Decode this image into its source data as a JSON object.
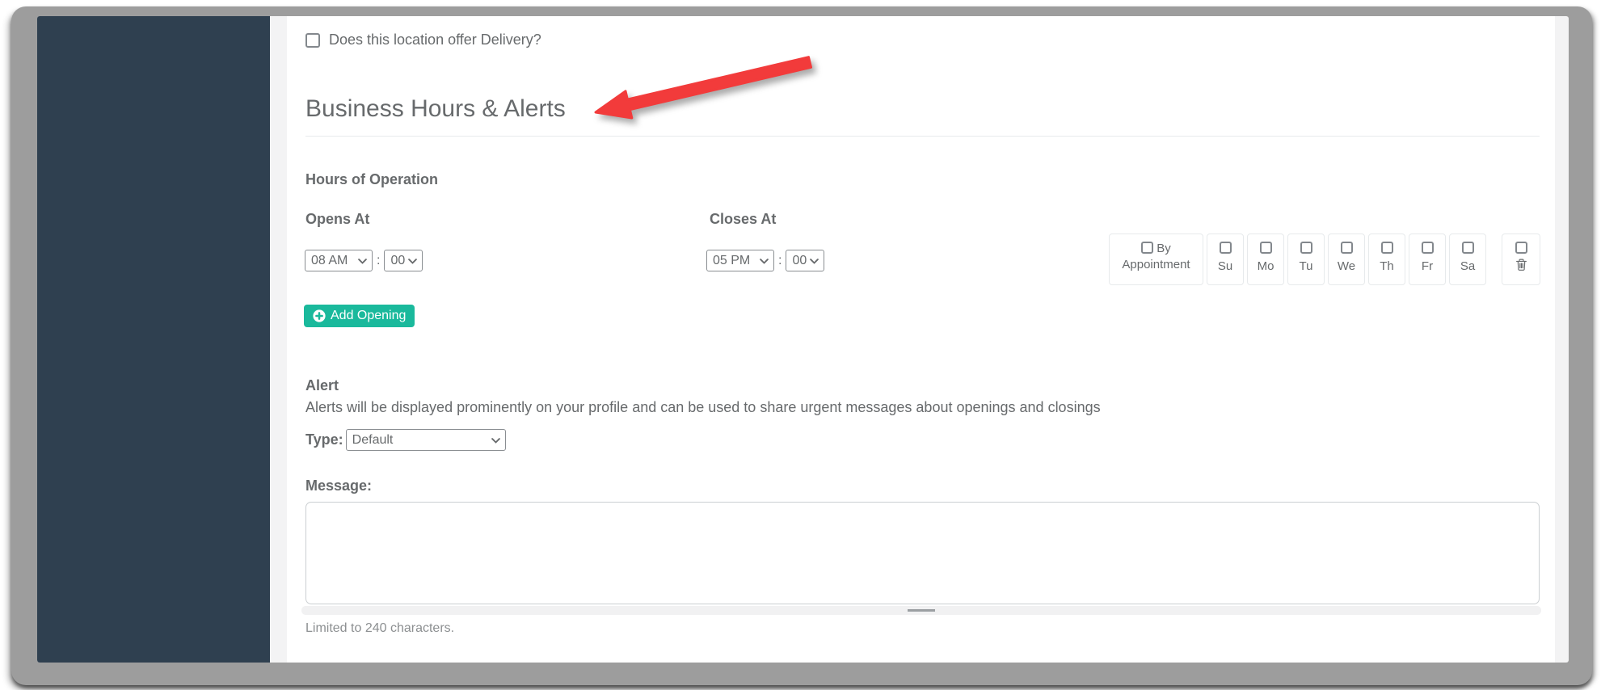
{
  "window": {
    "frame_color": "#9d9d9d",
    "sidebar_color": "#2f4050"
  },
  "form": {
    "delivery_label": "Does this location offer Delivery?",
    "section_title": "Business Hours & Alerts",
    "hours": {
      "title": "Hours of Operation",
      "opens_label": "Opens At",
      "closes_label": "Closes At",
      "time_separator": ":",
      "opens_hour": "08 AM",
      "opens_minute": "00",
      "closes_hour": "05 PM",
      "closes_minute": "00",
      "by_appointment_label": "By Appointment",
      "days": [
        "Su",
        "Mo",
        "Tu",
        "We",
        "Th",
        "Fr",
        "Sa"
      ],
      "add_opening_label": "Add Opening"
    },
    "alert": {
      "title": "Alert",
      "description": "Alerts will be displayed prominently on your profile and can be used to share urgent messages about openings and closings",
      "type_label": "Type:",
      "type_value": "Default",
      "message_label": "Message:",
      "message_value": "",
      "limit_note": "Limited to 240 characters."
    },
    "accent_color": "#1ab99c",
    "annotation_arrow_color": "#f23b3b"
  }
}
